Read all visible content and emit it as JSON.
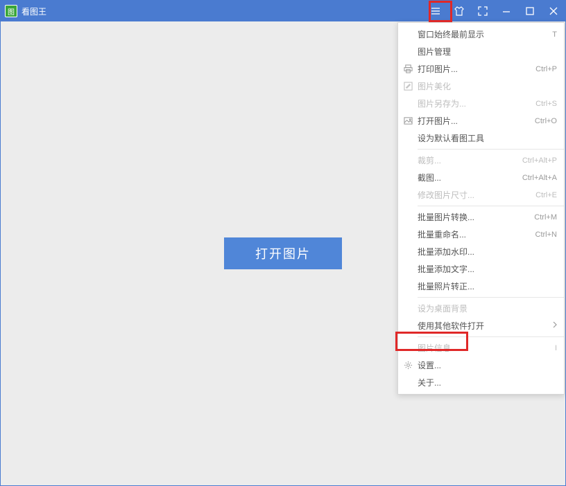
{
  "titlebar": {
    "app_name": "看图王"
  },
  "main": {
    "open_button": "打开图片"
  },
  "menu": {
    "always_on_top": {
      "label": "窗口始终最前显示",
      "shortcut": "T"
    },
    "image_manage": {
      "label": "图片管理"
    },
    "print": {
      "label": "打印图片...",
      "shortcut": "Ctrl+P"
    },
    "beautify": {
      "label": "图片美化"
    },
    "save_as": {
      "label": "图片另存为...",
      "shortcut": "Ctrl+S"
    },
    "open_image": {
      "label": "打开图片...",
      "shortcut": "Ctrl+O"
    },
    "set_default_viewer": {
      "label": "设为默认看图工具"
    },
    "crop": {
      "label": "裁剪...",
      "shortcut": "Ctrl+Alt+P"
    },
    "screenshot": {
      "label": "截图...",
      "shortcut": "Ctrl+Alt+A"
    },
    "resize": {
      "label": "修改图片尺寸...",
      "shortcut": "Ctrl+E"
    },
    "batch_convert": {
      "label": "批量图片转换...",
      "shortcut": "Ctrl+M"
    },
    "batch_rename": {
      "label": "批量重命名...",
      "shortcut": "Ctrl+N"
    },
    "batch_watermark": {
      "label": "批量添加水印..."
    },
    "batch_text": {
      "label": "批量添加文字..."
    },
    "batch_rotate": {
      "label": "批量照片转正..."
    },
    "set_wallpaper": {
      "label": "设为桌面背景"
    },
    "open_with": {
      "label": "使用其他软件打开"
    },
    "image_info": {
      "label": "图片信息...",
      "shortcut": "I"
    },
    "settings": {
      "label": "设置..."
    },
    "about": {
      "label": "关于..."
    }
  }
}
